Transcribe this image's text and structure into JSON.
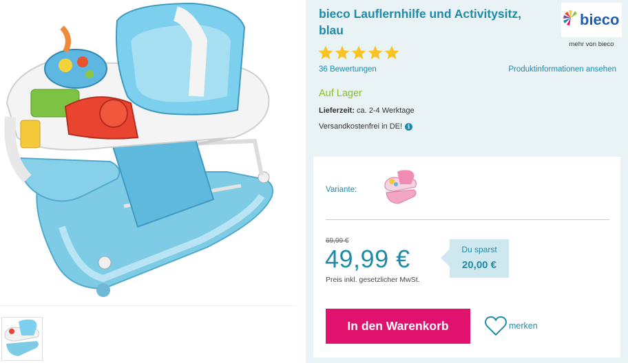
{
  "product": {
    "title": "bieco Lauflernhilfe und Activitysitz, blau",
    "rating_stars": 5,
    "reviews": "36 Bewertungen",
    "info_link": "Produktinformationen ansehen",
    "stock": "Auf Lager",
    "delivery_label": "Lieferzeit:",
    "delivery_value": "ca. 2-4 Werktage",
    "shipping": "Versandkostenfrei in DE!"
  },
  "brand": {
    "logo_text": "bieco",
    "link": "mehr von bieco"
  },
  "buybox": {
    "variant_label": "Variante:",
    "old_price": "69,99 €",
    "price": "49,99 €",
    "vat_note": "Preis inkl. gesetzlicher MwSt.",
    "savings_label": "Du sparst",
    "savings_value": "20,00 €",
    "cart_button": "In den Warenkorb",
    "wishlist": "merken"
  },
  "colors": {
    "accent": "#1d8ba8",
    "stock_green": "#8cbc2a",
    "cart_pink": "#e1126e",
    "star_yellow": "#f7c325",
    "panel_bg": "#e9f3f5"
  },
  "icons": [
    "star-icon",
    "info-icon",
    "heart-icon"
  ]
}
